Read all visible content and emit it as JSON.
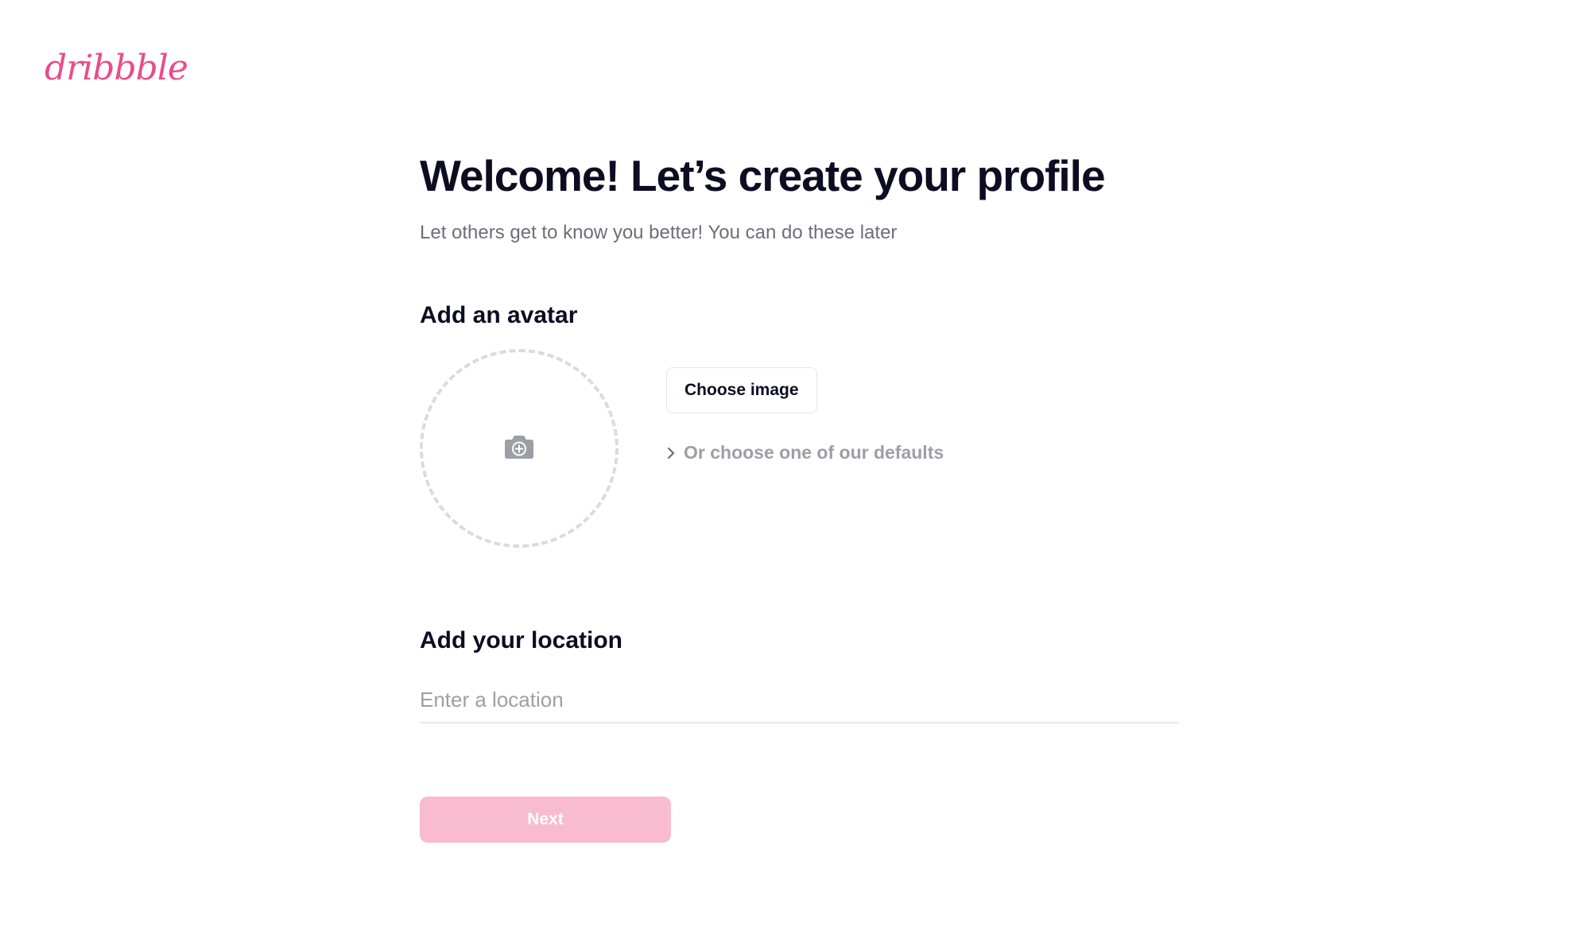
{
  "brand": {
    "logo_text": "dribbble",
    "color": "#ea4c89"
  },
  "header": {
    "title": "Welcome! Let’s create your profile",
    "subtitle": "Let others get to know you better! You can do these later"
  },
  "avatar": {
    "heading": "Add an avatar",
    "drop_icon": "camera-plus-icon",
    "choose_button_label": "Choose image",
    "defaults_link_icon": "chevron-right-icon",
    "defaults_link_label": "Or choose one of our defaults"
  },
  "location": {
    "heading": "Add your location",
    "value": "",
    "placeholder": "Enter a location"
  },
  "actions": {
    "next_label": "Next",
    "next_color": "#f8bbd0"
  },
  "colors": {
    "heading": "#0d0c22",
    "muted": "#6e6d7a",
    "placeholder": "#9e9ea7",
    "border": "#e7e7e9"
  }
}
